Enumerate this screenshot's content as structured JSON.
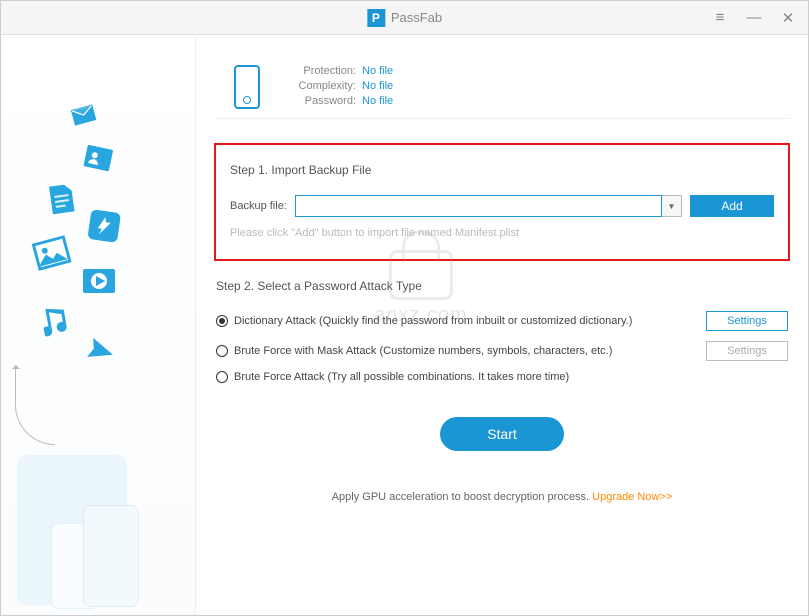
{
  "app": {
    "name": "PassFab"
  },
  "info": {
    "protection_label": "Protection:",
    "protection_value": "No file",
    "complexity_label": "Complexity:",
    "complexity_value": "No file",
    "password_label": "Password:",
    "password_value": "No file"
  },
  "step1": {
    "title": "Step 1. Import Backup File",
    "file_label": "Backup file:",
    "file_value": "",
    "add_label": "Add",
    "hint": "Please click \"Add\" button to import file named Manifest.plist"
  },
  "step2": {
    "title": "Step 2. Select a Password Attack Type",
    "options": [
      {
        "label": "Dictionary Attack (Quickly find the password from inbuilt or customized dictionary.)",
        "checked": true,
        "settings_enabled": true
      },
      {
        "label": "Brute Force with Mask Attack (Customize numbers, symbols, characters, etc.)",
        "checked": false,
        "settings_enabled": false
      },
      {
        "label": "Brute Force Attack (Try all possible combinations. It takes more time)",
        "checked": false,
        "settings_enabled": null
      }
    ],
    "settings_label": "Settings"
  },
  "start_label": "Start",
  "footer": {
    "text": "Apply GPU acceleration to boost decryption process.  ",
    "upgrade": "Upgrade Now>>"
  },
  "watermark": {
    "text": "anxz.com"
  }
}
